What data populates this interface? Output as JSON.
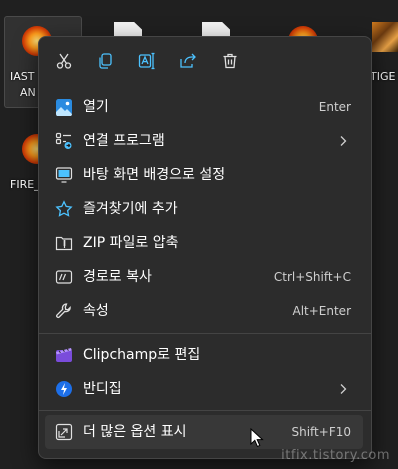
{
  "desktop": {
    "icons": [
      {
        "label_line1": "IAST",
        "label_line2": "AN"
      },
      {
        "label": "FIRE_"
      },
      {
        "label": "TIGE"
      }
    ]
  },
  "toolbar": {
    "cut": "cut-icon",
    "copy": "copy-icon",
    "rename": "rename-icon",
    "share": "share-icon",
    "delete": "delete-icon"
  },
  "menu": {
    "items": [
      {
        "label": "열기",
        "shortcut": "Enter",
        "icon": "image-icon"
      },
      {
        "label": "연결 프로그램",
        "shortcut": "",
        "icon": "open-with-icon",
        "submenu": true
      },
      {
        "label": "바탕 화면 배경으로 설정",
        "shortcut": "",
        "icon": "desktop-background-icon"
      },
      {
        "label": "즐겨찾기에 추가",
        "shortcut": "",
        "icon": "star-icon"
      },
      {
        "label": "ZIP 파일로 압축",
        "shortcut": "",
        "icon": "zip-folder-icon"
      },
      {
        "label": "경로로 복사",
        "shortcut": "Ctrl+Shift+C",
        "icon": "copy-path-icon"
      },
      {
        "label": "속성",
        "shortcut": "Alt+Enter",
        "icon": "wrench-icon"
      },
      {
        "label": "Clipchamp로 편집",
        "shortcut": "",
        "icon": "clipchamp-icon"
      },
      {
        "label": "반디집",
        "shortcut": "",
        "icon": "bandizip-icon",
        "submenu": true
      },
      {
        "label": "더 많은 옵션 표시",
        "shortcut": "Shift+F10",
        "icon": "more-options-icon"
      }
    ]
  },
  "watermark": "itfix.tistory.com",
  "colors": {
    "accent": "#4cc2ff",
    "menu_bg": "#2c2c2c",
    "hover": "#383838"
  }
}
